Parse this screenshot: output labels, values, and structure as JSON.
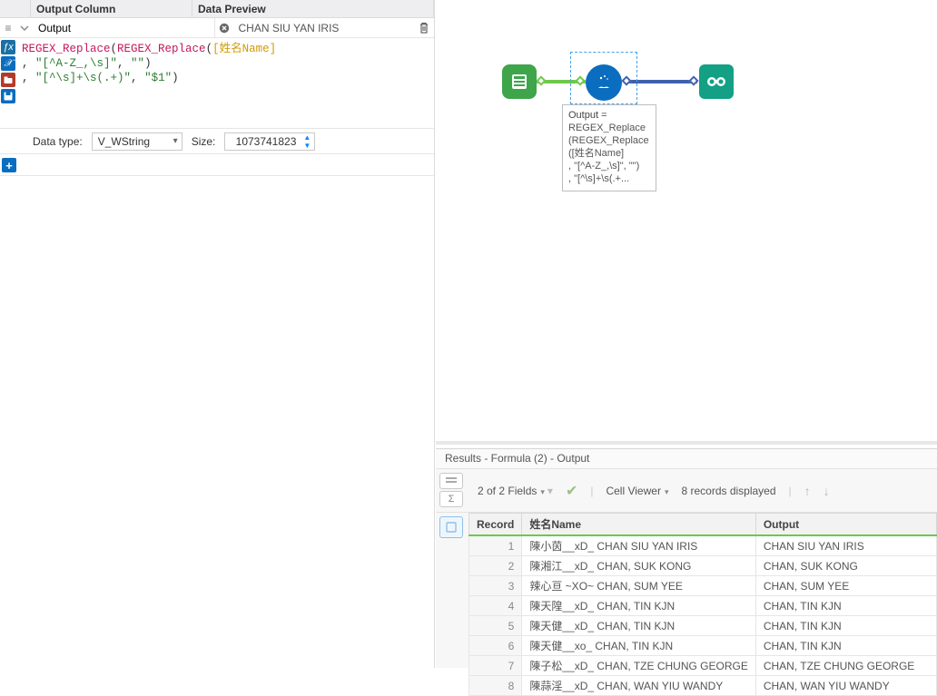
{
  "left": {
    "col1_header": "Output Column",
    "col2_header": "Data Preview",
    "output_name": "Output",
    "preview_value": "CHAN SIU YAN IRIS",
    "code": {
      "fn": "REGEX_Replace",
      "fld": "[姓名Name]",
      "s1": "\"[^A-Z_,\\s]\"",
      "s2": "\"\"",
      "s3": "\"[^\\s]+\\s(.+)\"",
      "s4": "\"$1\""
    },
    "dt_label": "Data type:",
    "dt_value": "V_WString",
    "size_label": "Size:",
    "size_value": "1073741823"
  },
  "annotation": {
    "l1": "Output =",
    "l2": "REGEX_Replace",
    "l3": "(REGEX_Replace",
    "l4": "([姓名Name]",
    "l5": ", \"[^A-Z_,\\s]\", \"\")",
    "l6": ", \"[^\\s]+\\s(.+..."
  },
  "results": {
    "title": "Results - Formula (2) - Output",
    "fields_text": "2 of 2 Fields",
    "cell_viewer": "Cell Viewer",
    "records_text": "8 records displayed",
    "headers": {
      "rec": "Record",
      "name": "姓名Name",
      "out": "Output"
    },
    "rows": [
      {
        "n": "1",
        "name": "陳小茵__xD_ CHAN SIU YAN IRIS",
        "out": "CHAN SIU YAN IRIS"
      },
      {
        "n": "2",
        "name": "陳湘江__xD_ CHAN, SUK KONG",
        "out": "CHAN, SUK KONG"
      },
      {
        "n": "3",
        "name": "辣心亘 ~XO~ CHAN, SUM YEE",
        "out": "CHAN, SUM YEE"
      },
      {
        "n": "4",
        "name": "陳天隍__xD_ CHAN, TIN KJN",
        "out": "CHAN, TIN KJN"
      },
      {
        "n": "5",
        "name": "陳天健__xD_ CHAN, TIN KJN",
        "out": "CHAN, TIN KJN"
      },
      {
        "n": "6",
        "name": "陳天健__xo_ CHAN, TIN KJN",
        "out": "CHAN, TIN KJN"
      },
      {
        "n": "7",
        "name": "陳子松__xD_ CHAN, TZE CHUNG GEORGE",
        "out": "CHAN, TZE CHUNG GEORGE"
      },
      {
        "n": "8",
        "name": "陳蒜淫__xD_ CHAN, WAN YIU WANDY",
        "out": "CHAN, WAN YIU WANDY"
      }
    ]
  }
}
